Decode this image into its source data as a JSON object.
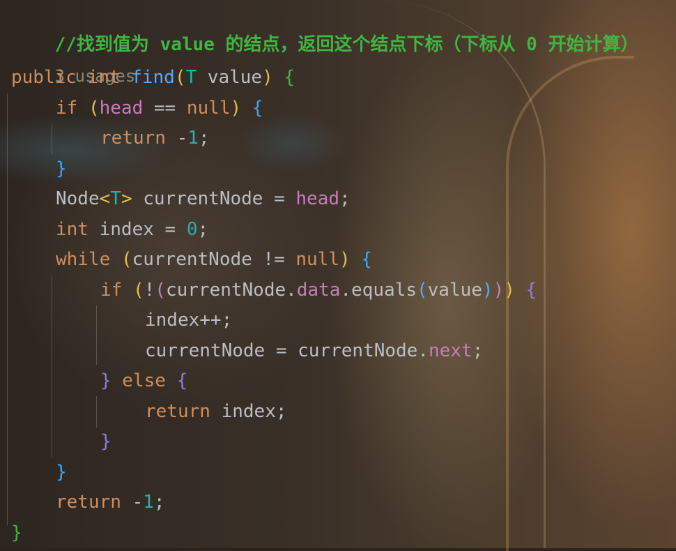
{
  "editor": {
    "comment": "//找到值为 value 的结点，返回这个结点下标（下标从 0 开始计算）",
    "usages": "3 usages",
    "lines": {
      "l3": {
        "kw1": "public",
        "kw2": "int",
        "method": "find",
        "p1": "(",
        "type": "T",
        "param": " value",
        "p2": ")",
        "brace": "{"
      },
      "l4": {
        "kw": "if",
        "p1": "(",
        "field": "head",
        "op": " == ",
        "kw2": "null",
        "p2": ")",
        "brace": "{"
      },
      "l5": {
        "kw": "return",
        "op": " -",
        "num": "1",
        "semi": ";"
      },
      "l6": {
        "brace": "}"
      },
      "l7": {
        "ident": "Node",
        "lt": "<",
        "type": "T",
        "gt": ">",
        "var": " currentNode = ",
        "field": "head",
        "semi": ";"
      },
      "l8": {
        "kw": "int",
        "var": " index = ",
        "num": "0",
        "semi": ";"
      },
      "l9": {
        "kw": "while",
        "p1": "(",
        "var": "currentNode != ",
        "kw2": "null",
        "p2": ")",
        "brace": "{"
      },
      "l10": {
        "kw": "if",
        "p1": "(",
        "not": "!",
        "p2": "(",
        "var": "currentNode.",
        "field": "data",
        "call": ".equals",
        "p3": "(",
        "arg": "value",
        "p4": ")",
        "p5": ")",
        "p6": ")",
        "brace": "{"
      },
      "l11": {
        "text": "index++;"
      },
      "l12": {
        "var": "currentNode = currentNode.",
        "field": "next",
        "semi": ";"
      },
      "l13": {
        "brace1": "}",
        "kw": " else ",
        "brace2": "{"
      },
      "l14": {
        "kw": "return",
        "var": " index;"
      },
      "l15": {
        "brace": "}"
      },
      "l16": {
        "brace": "}"
      },
      "l17": {
        "kw": "return",
        "op": " -",
        "num": "1",
        "semi": ";"
      },
      "l18": {
        "brace": "}"
      }
    }
  },
  "colors": {
    "comment": "#3fb642",
    "keyword": "#cf8e5c",
    "method": "#56a8f5",
    "type": "#16baac",
    "field": "#c77dbb",
    "number": "#2aacb8"
  }
}
